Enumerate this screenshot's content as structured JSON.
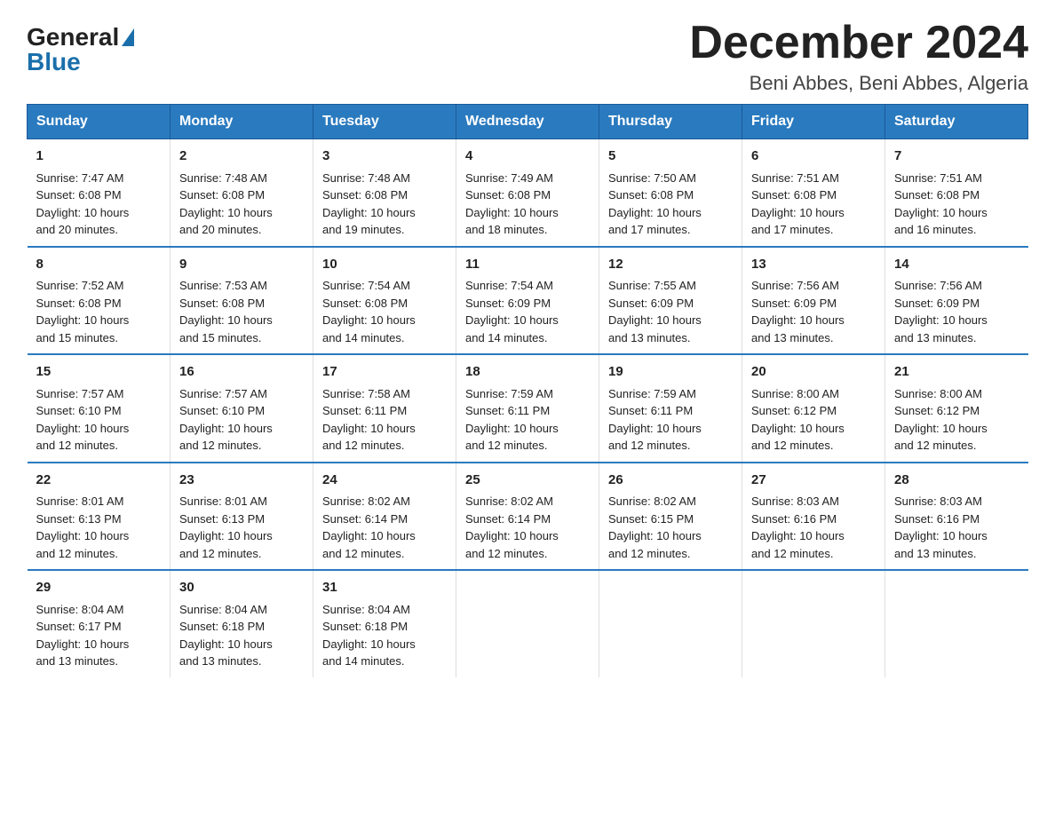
{
  "header": {
    "logo_general": "General",
    "logo_blue": "Blue",
    "month_title": "December 2024",
    "location": "Beni Abbes, Beni Abbes, Algeria"
  },
  "days_of_week": [
    "Sunday",
    "Monday",
    "Tuesday",
    "Wednesday",
    "Thursday",
    "Friday",
    "Saturday"
  ],
  "weeks": [
    [
      {
        "day": "1",
        "sunrise": "7:47 AM",
        "sunset": "6:08 PM",
        "daylight": "10 hours and 20 minutes."
      },
      {
        "day": "2",
        "sunrise": "7:48 AM",
        "sunset": "6:08 PM",
        "daylight": "10 hours and 20 minutes."
      },
      {
        "day": "3",
        "sunrise": "7:48 AM",
        "sunset": "6:08 PM",
        "daylight": "10 hours and 19 minutes."
      },
      {
        "day": "4",
        "sunrise": "7:49 AM",
        "sunset": "6:08 PM",
        "daylight": "10 hours and 18 minutes."
      },
      {
        "day": "5",
        "sunrise": "7:50 AM",
        "sunset": "6:08 PM",
        "daylight": "10 hours and 17 minutes."
      },
      {
        "day": "6",
        "sunrise": "7:51 AM",
        "sunset": "6:08 PM",
        "daylight": "10 hours and 17 minutes."
      },
      {
        "day": "7",
        "sunrise": "7:51 AM",
        "sunset": "6:08 PM",
        "daylight": "10 hours and 16 minutes."
      }
    ],
    [
      {
        "day": "8",
        "sunrise": "7:52 AM",
        "sunset": "6:08 PM",
        "daylight": "10 hours and 15 minutes."
      },
      {
        "day": "9",
        "sunrise": "7:53 AM",
        "sunset": "6:08 PM",
        "daylight": "10 hours and 15 minutes."
      },
      {
        "day": "10",
        "sunrise": "7:54 AM",
        "sunset": "6:08 PM",
        "daylight": "10 hours and 14 minutes."
      },
      {
        "day": "11",
        "sunrise": "7:54 AM",
        "sunset": "6:09 PM",
        "daylight": "10 hours and 14 minutes."
      },
      {
        "day": "12",
        "sunrise": "7:55 AM",
        "sunset": "6:09 PM",
        "daylight": "10 hours and 13 minutes."
      },
      {
        "day": "13",
        "sunrise": "7:56 AM",
        "sunset": "6:09 PM",
        "daylight": "10 hours and 13 minutes."
      },
      {
        "day": "14",
        "sunrise": "7:56 AM",
        "sunset": "6:09 PM",
        "daylight": "10 hours and 13 minutes."
      }
    ],
    [
      {
        "day": "15",
        "sunrise": "7:57 AM",
        "sunset": "6:10 PM",
        "daylight": "10 hours and 12 minutes."
      },
      {
        "day": "16",
        "sunrise": "7:57 AM",
        "sunset": "6:10 PM",
        "daylight": "10 hours and 12 minutes."
      },
      {
        "day": "17",
        "sunrise": "7:58 AM",
        "sunset": "6:11 PM",
        "daylight": "10 hours and 12 minutes."
      },
      {
        "day": "18",
        "sunrise": "7:59 AM",
        "sunset": "6:11 PM",
        "daylight": "10 hours and 12 minutes."
      },
      {
        "day": "19",
        "sunrise": "7:59 AM",
        "sunset": "6:11 PM",
        "daylight": "10 hours and 12 minutes."
      },
      {
        "day": "20",
        "sunrise": "8:00 AM",
        "sunset": "6:12 PM",
        "daylight": "10 hours and 12 minutes."
      },
      {
        "day": "21",
        "sunrise": "8:00 AM",
        "sunset": "6:12 PM",
        "daylight": "10 hours and 12 minutes."
      }
    ],
    [
      {
        "day": "22",
        "sunrise": "8:01 AM",
        "sunset": "6:13 PM",
        "daylight": "10 hours and 12 minutes."
      },
      {
        "day": "23",
        "sunrise": "8:01 AM",
        "sunset": "6:13 PM",
        "daylight": "10 hours and 12 minutes."
      },
      {
        "day": "24",
        "sunrise": "8:02 AM",
        "sunset": "6:14 PM",
        "daylight": "10 hours and 12 minutes."
      },
      {
        "day": "25",
        "sunrise": "8:02 AM",
        "sunset": "6:14 PM",
        "daylight": "10 hours and 12 minutes."
      },
      {
        "day": "26",
        "sunrise": "8:02 AM",
        "sunset": "6:15 PM",
        "daylight": "10 hours and 12 minutes."
      },
      {
        "day": "27",
        "sunrise": "8:03 AM",
        "sunset": "6:16 PM",
        "daylight": "10 hours and 12 minutes."
      },
      {
        "day": "28",
        "sunrise": "8:03 AM",
        "sunset": "6:16 PM",
        "daylight": "10 hours and 13 minutes."
      }
    ],
    [
      {
        "day": "29",
        "sunrise": "8:04 AM",
        "sunset": "6:17 PM",
        "daylight": "10 hours and 13 minutes."
      },
      {
        "day": "30",
        "sunrise": "8:04 AM",
        "sunset": "6:18 PM",
        "daylight": "10 hours and 13 minutes."
      },
      {
        "day": "31",
        "sunrise": "8:04 AM",
        "sunset": "6:18 PM",
        "daylight": "10 hours and 14 minutes."
      },
      {
        "day": "",
        "sunrise": "",
        "sunset": "",
        "daylight": ""
      },
      {
        "day": "",
        "sunrise": "",
        "sunset": "",
        "daylight": ""
      },
      {
        "day": "",
        "sunrise": "",
        "sunset": "",
        "daylight": ""
      },
      {
        "day": "",
        "sunrise": "",
        "sunset": "",
        "daylight": ""
      }
    ]
  ],
  "labels": {
    "sunrise_prefix": "Sunrise: ",
    "sunset_prefix": "Sunset: ",
    "daylight_prefix": "Daylight: "
  }
}
